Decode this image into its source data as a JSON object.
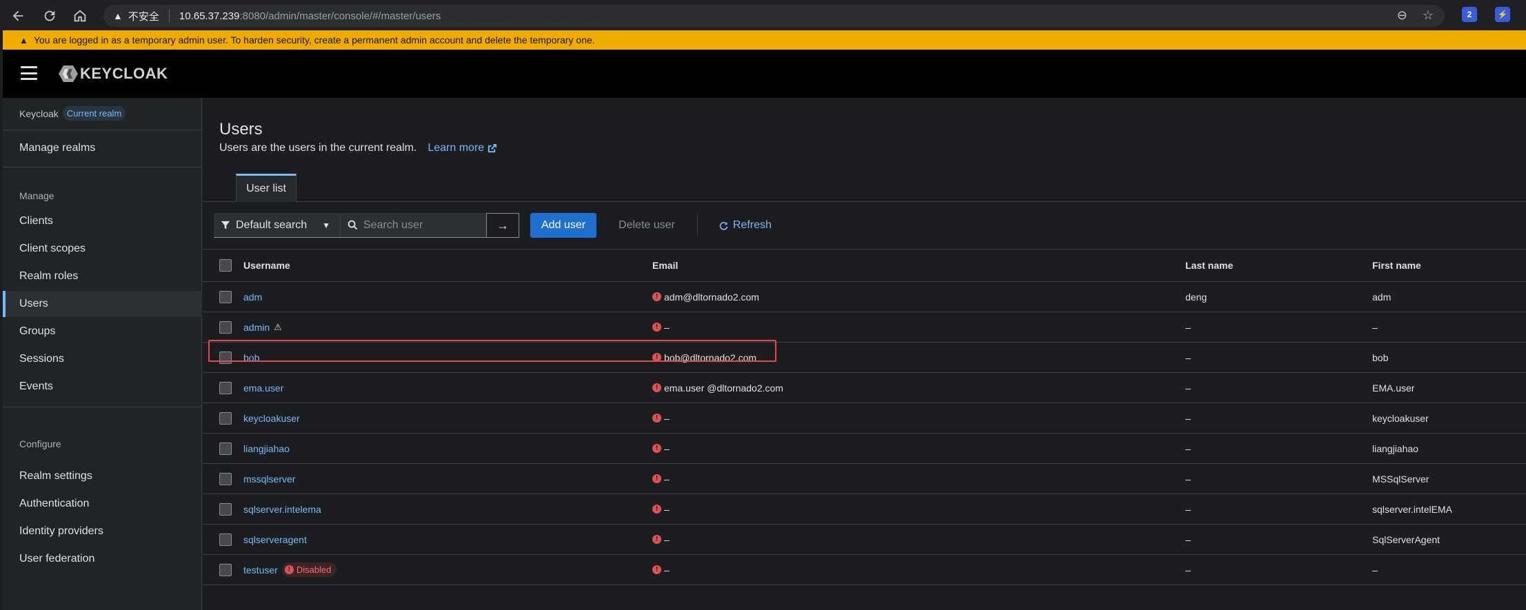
{
  "browser": {
    "security_label": "不安全",
    "url_host": "10.65.37.239",
    "url_path": ":8080/admin/master/console/#/master/users",
    "ext_badge": "2"
  },
  "banner": {
    "text": "You are logged in as a temporary admin user. To harden security, create a permanent admin account and delete the temporary one."
  },
  "masthead": {
    "logo_text": "KEYCLOAK"
  },
  "sidebar": {
    "realm_name": "Keycloak",
    "realm_badge": "Current realm",
    "manage_realms": "Manage realms",
    "manage_group": "Manage",
    "manage_items": [
      "Clients",
      "Client scopes",
      "Realm roles",
      "Users",
      "Groups",
      "Sessions",
      "Events"
    ],
    "configure_group": "Configure",
    "configure_items": [
      "Realm settings",
      "Authentication",
      "Identity providers",
      "User federation"
    ]
  },
  "page": {
    "title": "Users",
    "subtitle": "Users are the users in the current realm.",
    "learn_more": "Learn more",
    "tab_label": "User list"
  },
  "toolbar": {
    "filter_label": "Default search",
    "search_placeholder": "Search user",
    "add_user": "Add user",
    "delete_user": "Delete user",
    "refresh": "Refresh"
  },
  "table": {
    "headers": {
      "username": "Username",
      "email": "Email",
      "last_name": "Last name",
      "first_name": "First name"
    },
    "rows": [
      {
        "username": "adm",
        "email": "adm@dltornado2.com",
        "last_name": "deng",
        "first_name": "adm"
      },
      {
        "username": "admin",
        "email": "–",
        "last_name": "–",
        "first_name": "–"
      },
      {
        "username": "bob",
        "email": "bob@dltornado2.com",
        "last_name": "–",
        "first_name": "bob"
      },
      {
        "username": "ema.user",
        "email": "ema.user @dltornado2.com",
        "last_name": "–",
        "first_name": "EMA.user"
      },
      {
        "username": "keycloakuser",
        "email": "–",
        "last_name": "–",
        "first_name": "keycloakuser"
      },
      {
        "username": "liangjiahao",
        "email": "–",
        "last_name": "–",
        "first_name": "liangjiahao"
      },
      {
        "username": "mssqlserver",
        "email": "–",
        "last_name": "–",
        "first_name": "MSSqlServer"
      },
      {
        "username": "sqlserver.intelema",
        "email": "–",
        "last_name": "–",
        "first_name": "sqlserver.intelEMA"
      },
      {
        "username": "sqlserveragent",
        "email": "–",
        "last_name": "–",
        "first_name": "SqlServerAgent"
      },
      {
        "username": "testuser",
        "email": "–",
        "last_name": "–",
        "first_name": "–",
        "badge": "Disabled"
      }
    ]
  },
  "colors": {
    "accent": "#73bcf7",
    "primary_button": "#1f6fd0",
    "banner": "#f0ab00",
    "error": "#e05252",
    "highlight": "#e5484d"
  }
}
